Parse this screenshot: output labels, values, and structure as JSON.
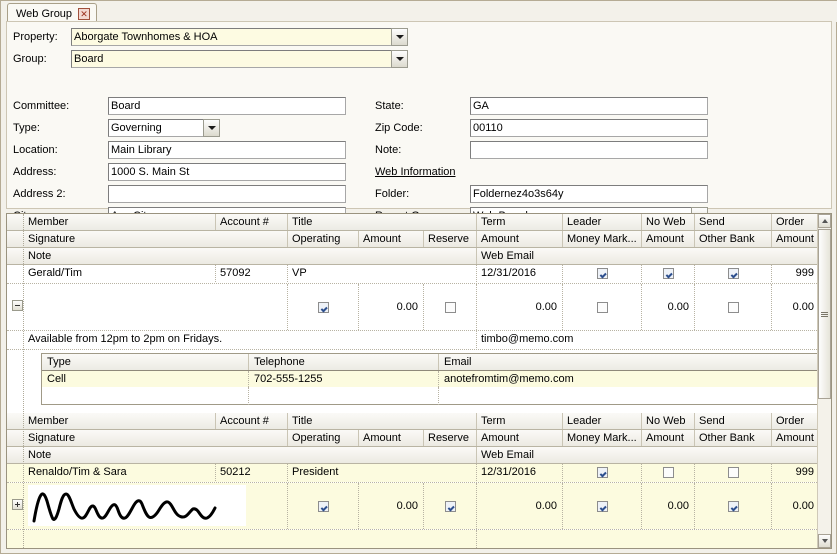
{
  "tab": {
    "label": "Web Group",
    "close_icon": "close-icon",
    "close_glyph": "✕"
  },
  "top": {
    "property_label": "Property:",
    "property_value": "Aborgate Townhomes & HOA",
    "group_label": "Group:",
    "group_value": "Board"
  },
  "form": {
    "left": [
      {
        "label": "Committee:",
        "value": "Board",
        "type": "text"
      },
      {
        "label": "Type:",
        "value": "Governing",
        "type": "combo"
      },
      {
        "label": "Location:",
        "value": "Main Library",
        "type": "text"
      },
      {
        "label": "Address:",
        "value": "1000 S. Main St",
        "type": "text"
      },
      {
        "label": "Address 2:",
        "value": "",
        "type": "text"
      },
      {
        "label": "City:",
        "value": "Any City",
        "type": "text"
      }
    ],
    "right": [
      {
        "label": "State:",
        "value": "GA",
        "type": "text"
      },
      {
        "label": "Zip Code:",
        "value": "00110",
        "type": "text"
      },
      {
        "label": "Note:",
        "value": "",
        "type": "text"
      },
      {
        "label": "Web Information",
        "value": "",
        "type": "section"
      },
      {
        "label": "Folder:",
        "value": "Foldernez4o3s64y",
        "type": "text"
      },
      {
        "label": "Report Group:",
        "value": "Web Board",
        "type": "combo"
      }
    ]
  },
  "grid": {
    "header_row1": [
      "Member",
      "Account #",
      "Title",
      "Term",
      "Leader",
      "No Web",
      "Send",
      "Order"
    ],
    "header_row2": [
      "Signature",
      "Operating",
      "Amount",
      "Reserve",
      "Amount",
      "Money  Mark...",
      "Amount",
      "Other Bank",
      "Amount"
    ],
    "header_row3": [
      "Note",
      "Web Email"
    ],
    "records": [
      {
        "member": "Gerald/Tim",
        "account": "57092",
        "title": "VP",
        "term": "12/31/2016",
        "leader_checked": true,
        "noweb_checked": true,
        "send_checked": true,
        "order": "999",
        "signature": "",
        "operating_checked": true,
        "operating_amount": "0.00",
        "reserve_checked": false,
        "reserve_amount": "0.00",
        "moneymarket_checked": false,
        "moneymarket_amount": "0.00",
        "otherbank_checked": false,
        "otherbank_amount": "0.00",
        "note": "Available from 12pm to 2pm on Fridays.",
        "web_email": "timbo@memo.com",
        "expander": "minus",
        "expanded": true,
        "contacts": {
          "headers": [
            "Type",
            "Telephone",
            "Email"
          ],
          "rows": [
            {
              "type": "Cell",
              "telephone": "702-555-1255",
              "email": "anotefromtim@memo.com"
            }
          ]
        }
      },
      {
        "member": "Renaldo/Tim & Sara",
        "account": "50212",
        "title": "President",
        "term": "12/31/2016",
        "leader_checked": true,
        "noweb_checked": false,
        "send_checked": false,
        "order": "999",
        "signature": "signature-image",
        "operating_checked": true,
        "operating_amount": "0.00",
        "reserve_checked": true,
        "reserve_amount": "0.00",
        "moneymarket_checked": true,
        "moneymarket_amount": "0.00",
        "otherbank_checked": true,
        "otherbank_amount": "0.00",
        "note": "",
        "web_email": "",
        "expander": "plus",
        "expanded": false,
        "selected": true
      }
    ]
  },
  "scrollbar": {
    "up_icon": "arrow-up-icon",
    "down_icon": "arrow-down-icon",
    "thumb": "scroll-thumb"
  },
  "colors": {
    "window_bg": "#f3f1ea",
    "panel_bg": "#faf9f4",
    "field_yellow": "#fdfbe2",
    "row_highlight": "#fcfbdf",
    "check_blue": "#2d4f8e",
    "border": "#9a937f"
  }
}
